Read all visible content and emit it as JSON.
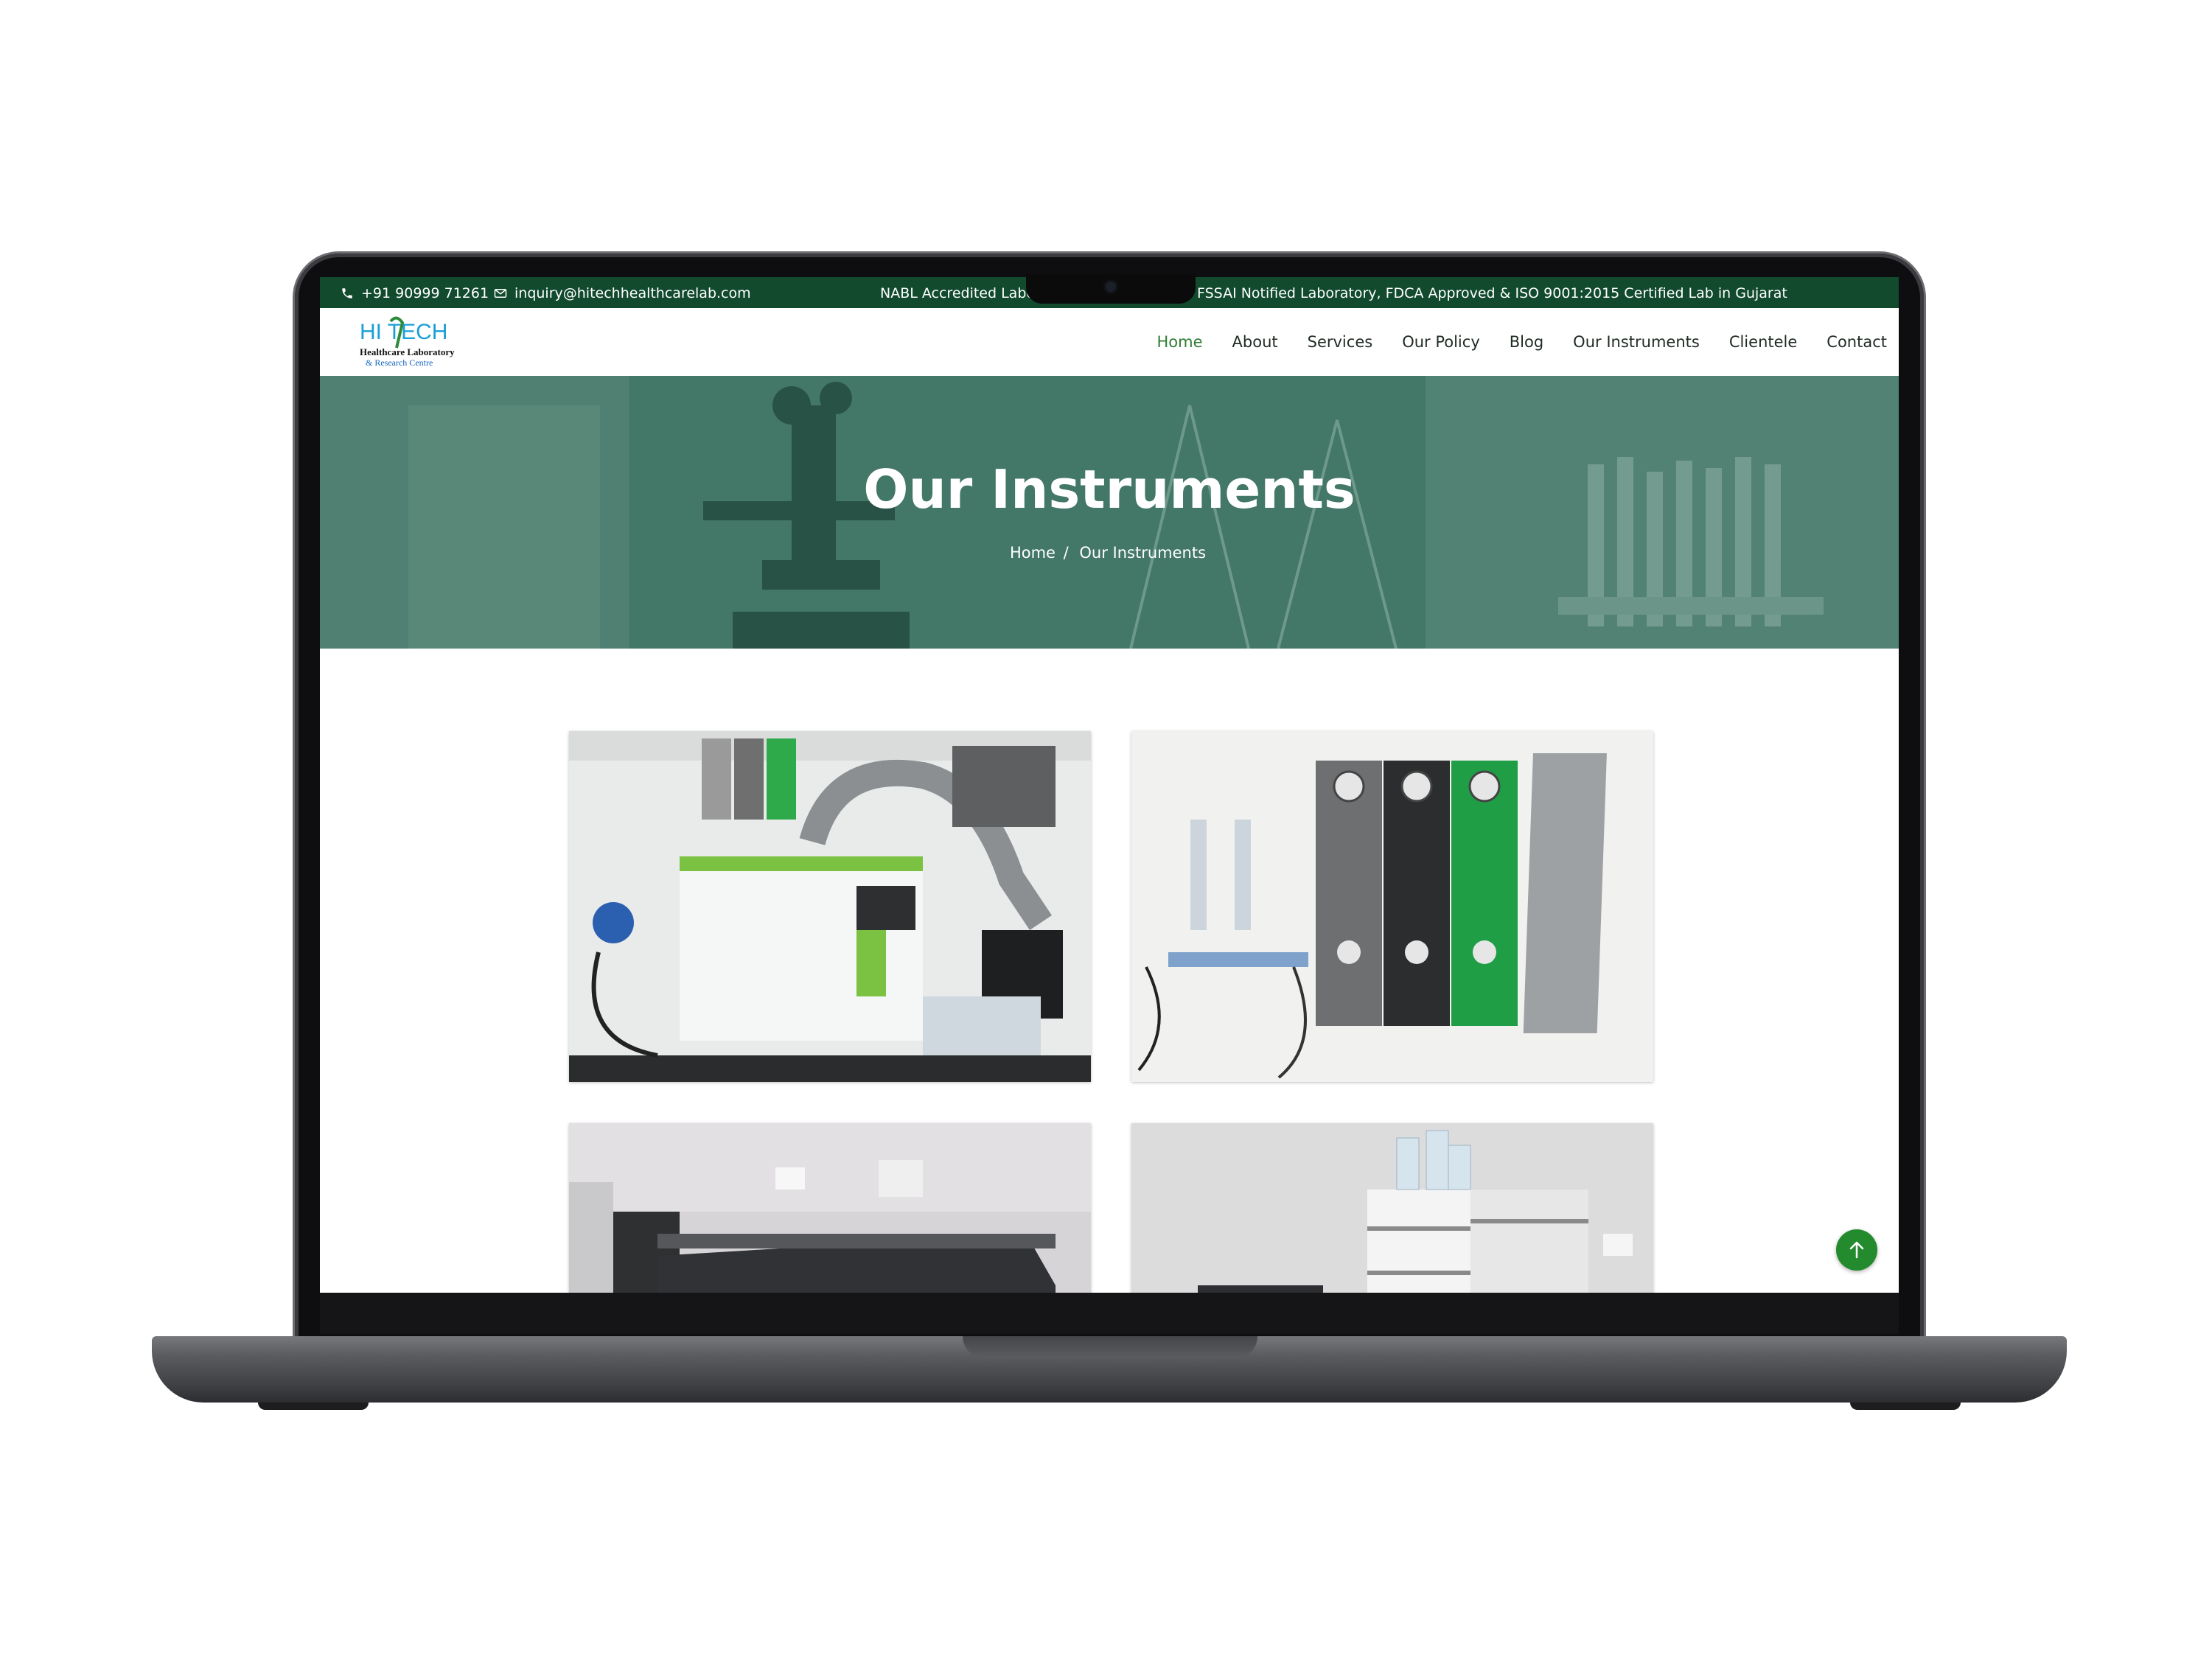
{
  "topbar": {
    "phone": "+91 90999 71261",
    "email": "inquiry@hitechhealthcarelab.com",
    "notice_left": "NABL Accredited Labor",
    "notice_right": "FSSAI Notified Laboratory, FDCA Approved & ISO 9001:2015 Certified Lab in Gujarat"
  },
  "logo": {
    "line1": "HI TECH",
    "line2": "Healthcare Laboratory",
    "line3": "& Research Centre"
  },
  "nav": {
    "items": [
      {
        "label": "Home",
        "active": true
      },
      {
        "label": "About"
      },
      {
        "label": "Services"
      },
      {
        "label": "Our Policy"
      },
      {
        "label": "Blog"
      },
      {
        "label": "Our Instruments"
      },
      {
        "label": "Clientele"
      },
      {
        "label": "Contact"
      }
    ]
  },
  "hero": {
    "title": "Our Instruments",
    "breadcrumb_home": "Home",
    "breadcrumb_sep": "/",
    "breadcrumb_current": "Our Instruments"
  },
  "gallery": {
    "images": [
      {
        "icon": "mass-spectrometer-photo"
      },
      {
        "icon": "gas-regulator-panel-photo"
      },
      {
        "icon": "lab-instrument-photo"
      },
      {
        "icon": "hplc-system-photo"
      }
    ]
  },
  "colors": {
    "topbar_bg": "#114a2c",
    "nav_active": "#2e7d32",
    "hero_overlay": "#2f6b59",
    "scroll_button": "#238a2e"
  },
  "icons": {
    "phone": "phone-icon",
    "email": "mail-icon",
    "scroll_top": "arrow-up-icon"
  }
}
